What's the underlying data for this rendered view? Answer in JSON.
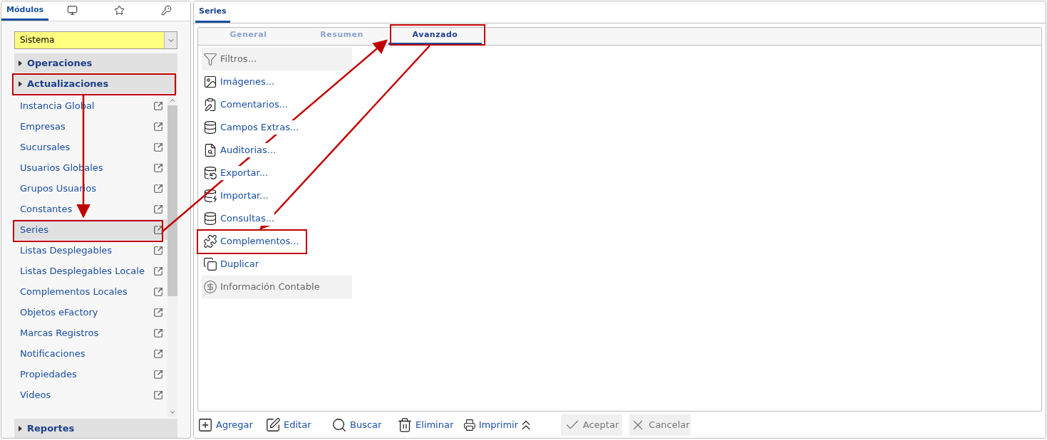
{
  "sidebar": {
    "tabs": [
      {
        "kind": "text",
        "label": "Módulos",
        "selected": true
      },
      {
        "kind": "monitor",
        "selected": false
      },
      {
        "kind": "star",
        "selected": false
      },
      {
        "kind": "key",
        "selected": false
      }
    ],
    "module_select": {
      "value": "Sistema"
    },
    "groups": [
      {
        "label": "Operaciones"
      },
      {
        "label": "Actualizaciones",
        "items": [
          {
            "label": "Instancia Global",
            "selected": false
          },
          {
            "label": "Empresas",
            "selected": false
          },
          {
            "label": "Sucursales",
            "selected": false
          },
          {
            "label": "Usuarios Globales",
            "selected": false
          },
          {
            "label": "Grupos Usuarios",
            "selected": false
          },
          {
            "label": "Constantes",
            "selected": false
          },
          {
            "label": "Series",
            "selected": true
          },
          {
            "label": "Listas Desplegables",
            "selected": false
          },
          {
            "label": "Listas Desplegables Locale",
            "selected": false
          },
          {
            "label": "Complementos Locales",
            "selected": false
          },
          {
            "label": "Objetos eFactory",
            "selected": false
          },
          {
            "label": "Marcas Registros",
            "selected": false
          },
          {
            "label": "Notificaciones",
            "selected": false
          },
          {
            "label": "Propiedades",
            "selected": false
          },
          {
            "label": "Videos",
            "selected": false
          }
        ]
      },
      {
        "label": "Reportes"
      }
    ]
  },
  "main": {
    "tab": {
      "label": "Series",
      "selected": true
    },
    "subtabs": [
      {
        "label": "General",
        "selected": false
      },
      {
        "label": "Resumen",
        "selected": false
      },
      {
        "label": "Avanzado",
        "selected": true
      }
    ],
    "actions": [
      {
        "kind": "filter",
        "label": "Filtros...",
        "disabled": true
      },
      {
        "kind": "image",
        "label": "Imágenes...",
        "disabled": false
      },
      {
        "kind": "comment",
        "label": "Comentarios...",
        "disabled": false
      },
      {
        "kind": "database",
        "label": "Campos Extras...",
        "disabled": false
      },
      {
        "kind": "audit",
        "label": "Auditorias...",
        "disabled": false
      },
      {
        "kind": "export",
        "label": "Exportar...",
        "disabled": false
      },
      {
        "kind": "import",
        "label": "Importar...",
        "disabled": false
      },
      {
        "kind": "database",
        "label": "Consultas...",
        "disabled": false
      },
      {
        "kind": "puzzle",
        "label": "Complementos...",
        "disabled": false
      },
      {
        "kind": "copy",
        "label": "Duplicar",
        "disabled": false
      },
      {
        "kind": "dollar",
        "label": "Información Contable",
        "disabled": true
      }
    ],
    "toolbar": [
      {
        "kind": "add",
        "label": "Agregar",
        "disabled": false
      },
      {
        "kind": "edit",
        "label": "Editar",
        "disabled": false
      },
      {
        "kind": "search",
        "label": "Buscar",
        "disabled": false
      },
      {
        "kind": "delete",
        "label": "Eliminar",
        "disabled": false
      },
      {
        "kind": "print",
        "label": "Imprimir",
        "disabled": false
      },
      {
        "kind": "collapse",
        "disabled": false
      },
      {
        "kind": "accept",
        "label": "Aceptar",
        "disabled": true
      },
      {
        "kind": "cancel",
        "label": "Cancelar",
        "disabled": true
      }
    ]
  }
}
